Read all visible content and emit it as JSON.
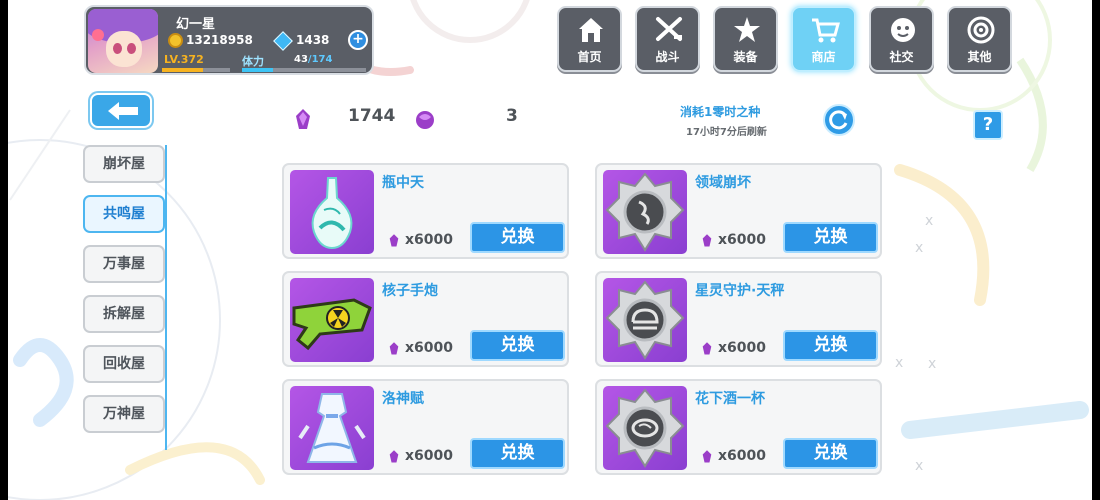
{
  "player": {
    "name": "幻一星",
    "gold": "13218958",
    "crystals": "1438",
    "level_label": "LV.372",
    "level_progress": 0.6,
    "stamina_label": "体力",
    "stamina_current": "43",
    "stamina_max": "/174",
    "stamina_progress": 0.25
  },
  "nav": [
    {
      "label": "首页",
      "icon": "house-icon"
    },
    {
      "label": "战斗",
      "icon": "crossed-swords-icon"
    },
    {
      "label": "装备",
      "icon": "star-gun-icon"
    },
    {
      "label": "商店",
      "icon": "shopping-cart-icon",
      "active": true
    },
    {
      "label": "社交",
      "icon": "friend-face-icon"
    },
    {
      "label": "其他",
      "icon": "target-icon"
    }
  ],
  "tabs": [
    {
      "label": "崩坏屋"
    },
    {
      "label": "共鸣屋",
      "active": true
    },
    {
      "label": "万事屋"
    },
    {
      "label": "拆解屋"
    },
    {
      "label": "回收屋"
    },
    {
      "label": "万神屋"
    }
  ],
  "currency": {
    "primary_amount": "1744",
    "secondary_amount": "3"
  },
  "refresh": {
    "title": "消耗1零时之种",
    "time": "17小时7分后刷新"
  },
  "help_label": "?",
  "items": [
    {
      "name": "瓶中天",
      "price": "x6000",
      "button": "兑换",
      "thumb": "vase"
    },
    {
      "name": "领域崩坏",
      "price": "x6000",
      "button": "兑换",
      "thumb": "badge"
    },
    {
      "name": "核子手炮",
      "price": "x6000",
      "button": "兑换",
      "thumb": "cannon"
    },
    {
      "name": "星灵守护·天秤",
      "price": "x6000",
      "button": "兑换",
      "thumb": "badge"
    },
    {
      "name": "洛神赋",
      "price": "x6000",
      "button": "兑换",
      "thumb": "dress"
    },
    {
      "name": "花下酒一杯",
      "price": "x6000",
      "button": "兑换",
      "thumb": "badge"
    }
  ],
  "colors": {
    "accent_blue": "#2c95e6",
    "item_name": "#2e9be0",
    "thumb_purple": "#b456e6",
    "gold": "#f7b320"
  }
}
